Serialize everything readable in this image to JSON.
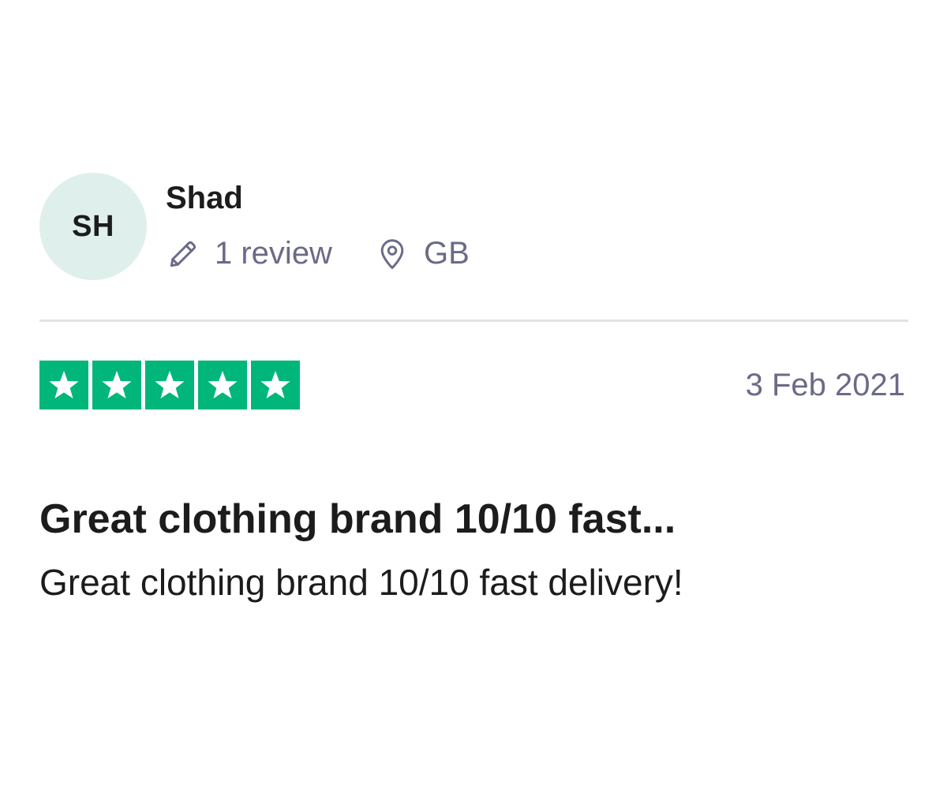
{
  "consumer": {
    "initials": "SH",
    "name": "Shad",
    "review_count": "1 review",
    "country": "GB",
    "avatar_color": "#dfefec"
  },
  "review": {
    "rating": 5,
    "max_rating": 5,
    "star_color": "#00b67a",
    "date": "3 Feb 2021",
    "title": "Great clothing brand 10/10 fast...",
    "text": "Great clothing brand 10/10 fast delivery!"
  },
  "icons": {
    "review_count": "pencil-icon",
    "location": "location-pin-icon",
    "star": "star-icon"
  },
  "colors": {
    "meta_text": "#6b6a87",
    "primary_text": "#1c1c1c",
    "divider": "#e3e3e3"
  }
}
